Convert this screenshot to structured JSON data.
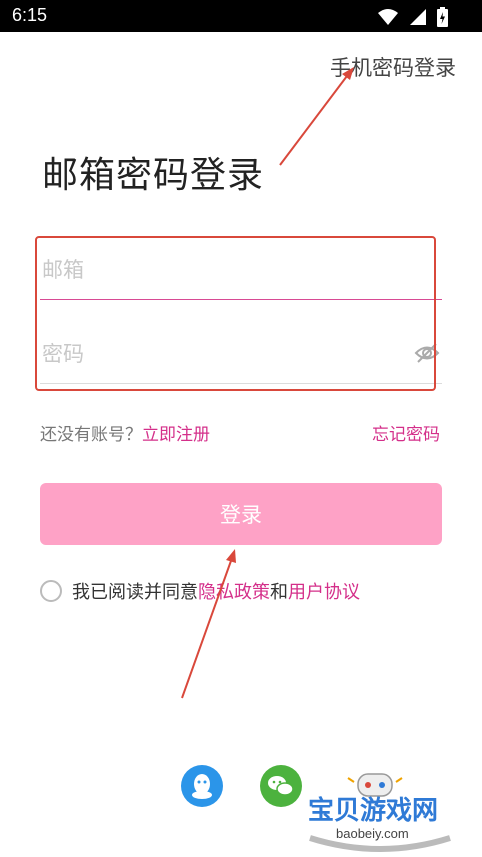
{
  "status_bar": {
    "time": "6:15"
  },
  "header": {
    "phone_login_link": "手机密码登录"
  },
  "page_title": "邮箱密码登录",
  "form": {
    "email_placeholder": "邮箱",
    "password_placeholder": "密码"
  },
  "links": {
    "no_account": "还没有账号？",
    "register": "立即注册",
    "forgot_password": "忘记密码"
  },
  "login_button_label": "登录",
  "agreement": {
    "prefix": "我已阅读并同意",
    "privacy_policy": "隐私政策",
    "and": "和",
    "user_agreement": "用户协议"
  },
  "watermark": {
    "title": "宝贝游戏网",
    "url": "baobeiy.com"
  },
  "colors": {
    "accent": "#d42f8a",
    "button": "#fea2c6",
    "annotation": "#d9483b"
  }
}
